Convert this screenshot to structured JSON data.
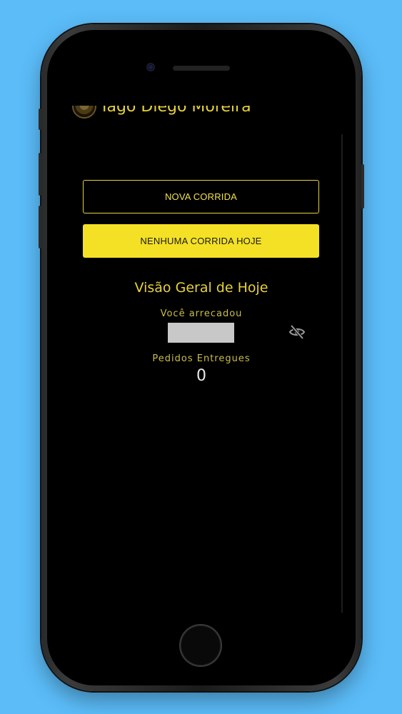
{
  "user": {
    "name": "Iago Diego Moreira"
  },
  "actions": {
    "new_ride_label": "NOVA CORRIDA",
    "no_rides_label": "NENHUMA CORRIDA HOJE"
  },
  "overview": {
    "title": "Visão Geral de Hoje",
    "earned_label": "Você arrecadou",
    "earned_value_hidden": true,
    "orders_label": "Pedidos Entregues",
    "orders_value": "0"
  },
  "icons": {
    "visibility_toggle": "eye-off-icon"
  },
  "colors": {
    "accent": "#f4e125",
    "accent_text": "#e8d23a",
    "background": "#000000",
    "page_background": "#5bbcf8",
    "hidden_value_mask": "#c8c8c8"
  }
}
